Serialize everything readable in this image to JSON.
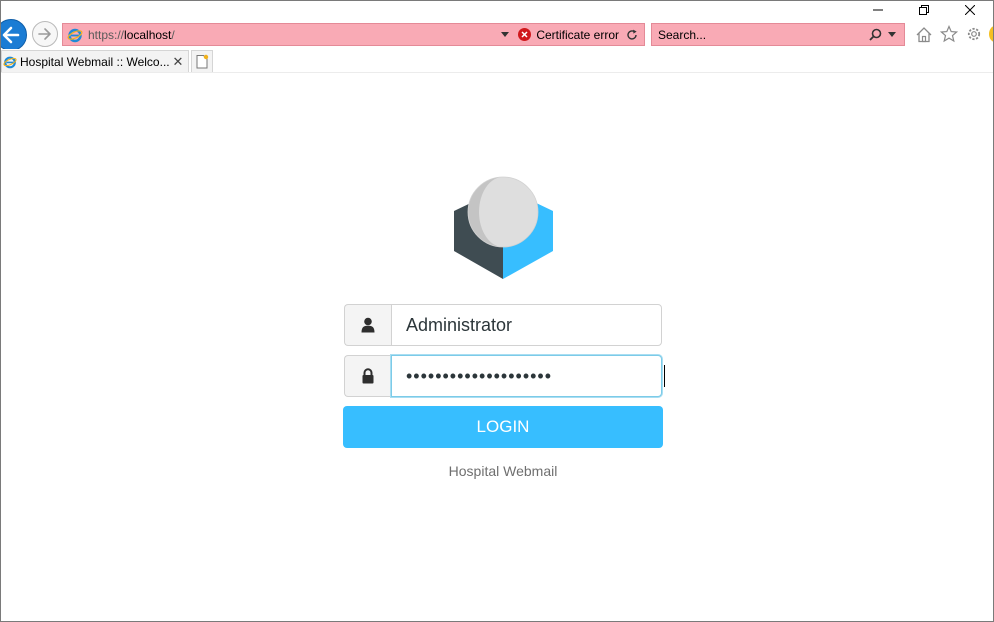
{
  "browser": {
    "address": {
      "protocol": "https://",
      "host": "localhost",
      "path": "/",
      "certificate_status": "Certificate error"
    },
    "search": {
      "placeholder": "Search..."
    },
    "tab": {
      "title": "Hospital Webmail :: Welco...",
      "close_glyph": "✕"
    },
    "icons": [
      "back-arrow-icon",
      "forward-arrow-icon",
      "ie-icon",
      "certificate-error-icon",
      "refresh-icon",
      "search-icon",
      "home-icon",
      "favorites-star-icon",
      "gear-icon",
      "new-tab-icon",
      "minimize-icon",
      "restore-icon",
      "close-icon"
    ]
  },
  "login": {
    "username": "Administrator",
    "password_masked": "••••••••••••••••••••",
    "button_label": "LOGIN",
    "footer": "Hospital Webmail"
  },
  "colors": {
    "accent": "#37beff",
    "logo_dark": "#3f4c52",
    "logo_blue": "#37beff",
    "address_error_bg": "#f9aab5"
  }
}
